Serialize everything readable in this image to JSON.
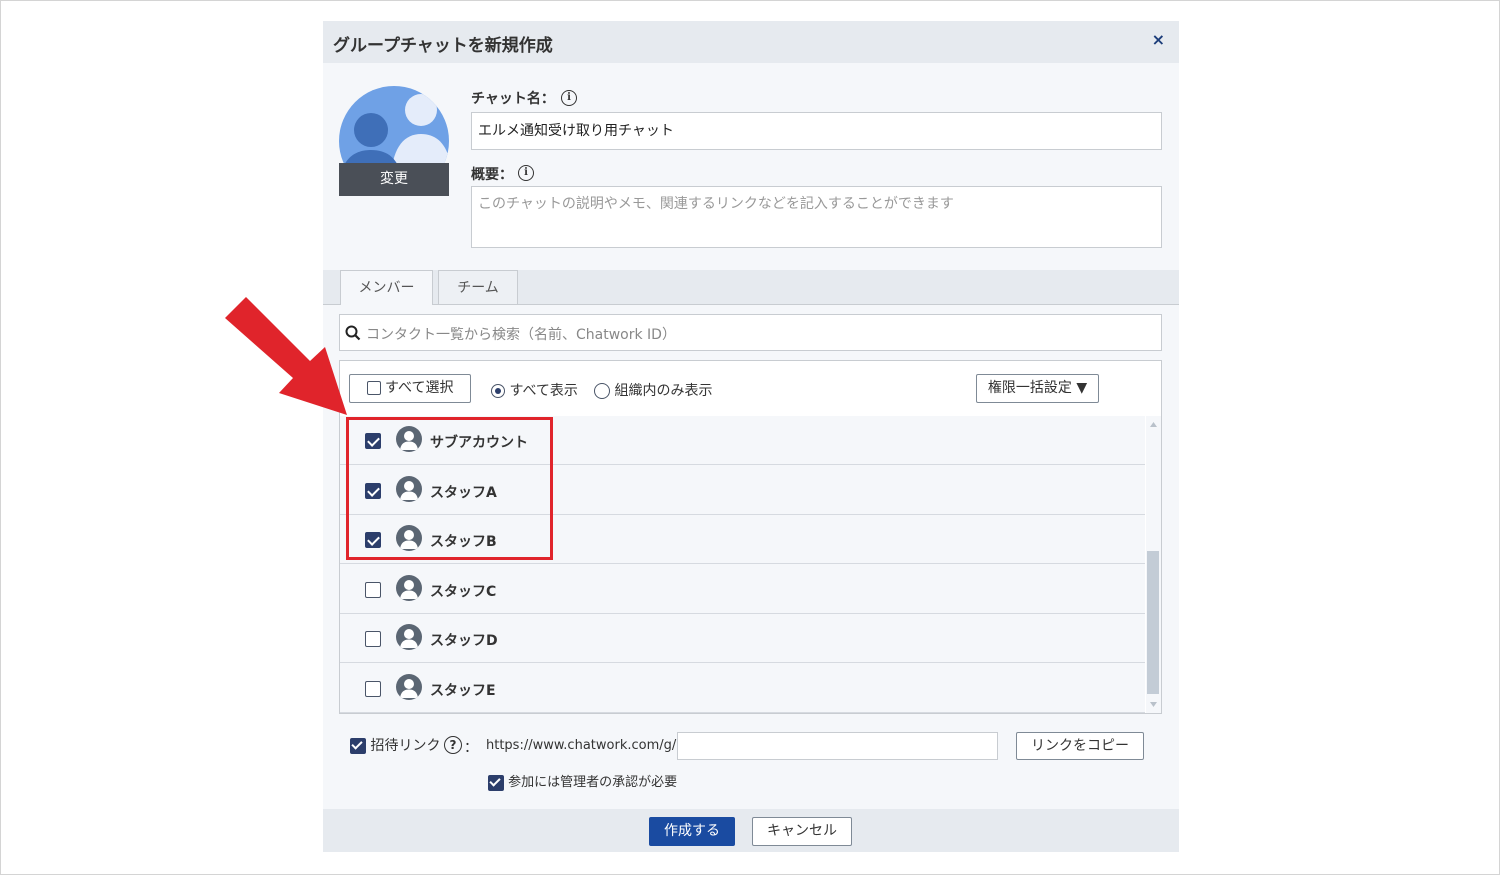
{
  "dialog": {
    "title": "グループチャットを新規作成",
    "close_label": "×",
    "avatar_change_label": "変更",
    "chat_name_label": "チャット名：",
    "chat_name_value": "エルメ通知受け取り用チャット",
    "description_label": "概要：",
    "description_placeholder": "このチャットの説明やメモ、関連するリンクなどを記入することができます",
    "info_glyph": "i"
  },
  "tabs": [
    {
      "label": "メンバー",
      "active": true
    },
    {
      "label": "チーム",
      "active": false
    }
  ],
  "search": {
    "placeholder": "コンタクト一覧から検索（名前、Chatwork ID）"
  },
  "toolbar": {
    "select_all_label": "すべて選択",
    "show_all_label": "すべて表示",
    "org_only_label": "組織内のみ表示",
    "bulk_permission_label": "権限一括設定 ▼"
  },
  "members": [
    {
      "name": "サブアカウント",
      "checked": true
    },
    {
      "name": "スタッフA",
      "checked": true
    },
    {
      "name": "スタッフB",
      "checked": true
    },
    {
      "name": "スタッフC",
      "checked": false
    },
    {
      "name": "スタッフD",
      "checked": false
    },
    {
      "name": "スタッフE",
      "checked": false
    }
  ],
  "invite": {
    "label": "招待リンク",
    "help_glyph": "?",
    "colon": "：",
    "url_prefix": "https://www.chatwork.com/g/",
    "url_value": "",
    "copy_label": "リンクをコピー",
    "approval_label": "参加には管理者の承認が必要"
  },
  "footer": {
    "create_label": "作成する",
    "cancel_label": "キャンセル"
  },
  "colors": {
    "annotation_arrow": "#e0242b",
    "primary_button": "#1a4ba1",
    "avatar_bg": "#6fa1e6"
  }
}
